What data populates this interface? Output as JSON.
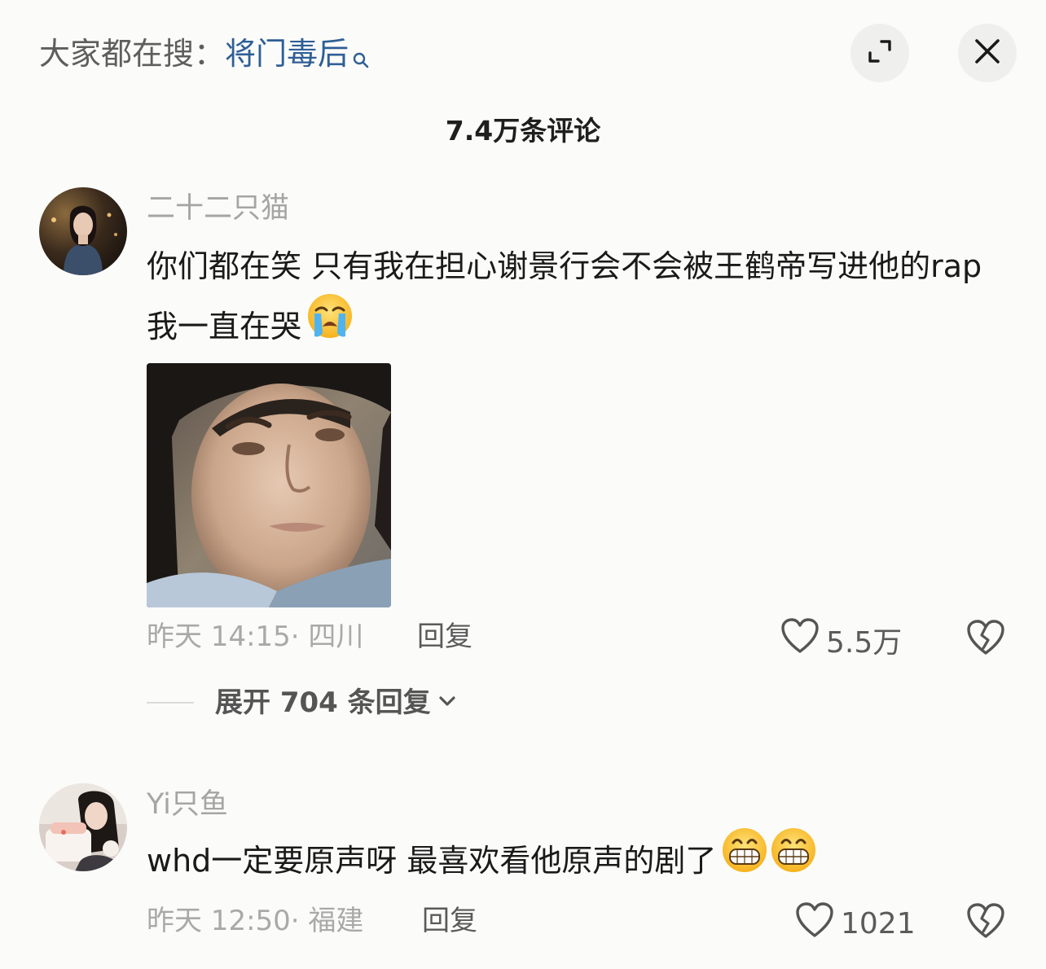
{
  "header": {
    "search_prefix": "大家都在搜：",
    "search_term": "将门毒后",
    "comment_count": "7.4万条评论"
  },
  "icons": {
    "search": "search-icon",
    "expand": "expand-icon",
    "close": "close-icon",
    "heart": "heart-icon",
    "broken_heart": "dislike-broken-heart-icon",
    "chevron": "chevron-down-icon"
  },
  "comments": [
    {
      "username": "二十二只猫",
      "text": "你们都在笑 只有我在担心谢景行会不会被王鹤帝写进他的rap 我一直在哭",
      "emoji": "loudly-crying-face",
      "time_location": "昨天 14:15· 四川",
      "reply_label": "回复",
      "likes": "5.5万",
      "expand_replies": "展开 704 条回复"
    },
    {
      "username": "Yi只鱼",
      "text": "whd一定要原声呀 最喜欢看他原声的剧了",
      "emoji": "grinning-face-x2",
      "time_location": "昨天 12:50· 福建",
      "reply_label": "回复",
      "likes": "1021"
    }
  ],
  "colors": {
    "background": "#fbfbf9",
    "search_term": "#2e5f96",
    "muted": "#a5a5a5"
  }
}
